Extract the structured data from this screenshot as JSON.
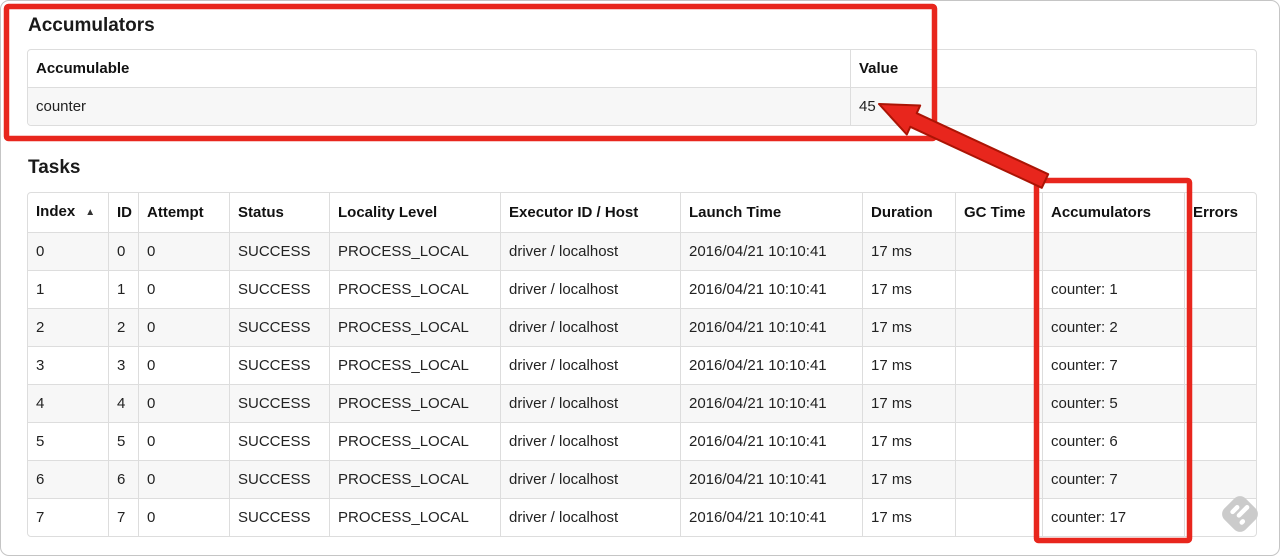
{
  "accumulators_section": {
    "heading": "Accumulators",
    "table": {
      "headers": [
        "Accumulable",
        "Value"
      ],
      "rows": [
        {
          "accumulable": "counter",
          "value": "45"
        }
      ]
    }
  },
  "tasks_section": {
    "heading": "Tasks",
    "table": {
      "headers": [
        "Index",
        "ID",
        "Attempt",
        "Status",
        "Locality Level",
        "Executor ID / Host",
        "Launch Time",
        "Duration",
        "GC Time",
        "Accumulators",
        "Errors"
      ],
      "sort_icon": "▲",
      "sorted_column": "Index",
      "rows": [
        {
          "index": "0",
          "id": "0",
          "attempt": "0",
          "status": "SUCCESS",
          "locality": "PROCESS_LOCAL",
          "executor": "driver / localhost",
          "launch_time": "2016/04/21 10:10:41",
          "duration": "17 ms",
          "gc_time": "",
          "accumulators": "",
          "errors": ""
        },
        {
          "index": "1",
          "id": "1",
          "attempt": "0",
          "status": "SUCCESS",
          "locality": "PROCESS_LOCAL",
          "executor": "driver / localhost",
          "launch_time": "2016/04/21 10:10:41",
          "duration": "17 ms",
          "gc_time": "",
          "accumulators": "counter: 1",
          "errors": ""
        },
        {
          "index": "2",
          "id": "2",
          "attempt": "0",
          "status": "SUCCESS",
          "locality": "PROCESS_LOCAL",
          "executor": "driver / localhost",
          "launch_time": "2016/04/21 10:10:41",
          "duration": "17 ms",
          "gc_time": "",
          "accumulators": "counter: 2",
          "errors": ""
        },
        {
          "index": "3",
          "id": "3",
          "attempt": "0",
          "status": "SUCCESS",
          "locality": "PROCESS_LOCAL",
          "executor": "driver / localhost",
          "launch_time": "2016/04/21 10:10:41",
          "duration": "17 ms",
          "gc_time": "",
          "accumulators": "counter: 7",
          "errors": ""
        },
        {
          "index": "4",
          "id": "4",
          "attempt": "0",
          "status": "SUCCESS",
          "locality": "PROCESS_LOCAL",
          "executor": "driver / localhost",
          "launch_time": "2016/04/21 10:10:41",
          "duration": "17 ms",
          "gc_time": "",
          "accumulators": "counter: 5",
          "errors": ""
        },
        {
          "index": "5",
          "id": "5",
          "attempt": "0",
          "status": "SUCCESS",
          "locality": "PROCESS_LOCAL",
          "executor": "driver / localhost",
          "launch_time": "2016/04/21 10:10:41",
          "duration": "17 ms",
          "gc_time": "",
          "accumulators": "counter: 6",
          "errors": ""
        },
        {
          "index": "6",
          "id": "6",
          "attempt": "0",
          "status": "SUCCESS",
          "locality": "PROCESS_LOCAL",
          "executor": "driver / localhost",
          "launch_time": "2016/04/21 10:10:41",
          "duration": "17 ms",
          "gc_time": "",
          "accumulators": "counter: 7",
          "errors": ""
        },
        {
          "index": "7",
          "id": "7",
          "attempt": "0",
          "status": "SUCCESS",
          "locality": "PROCESS_LOCAL",
          "executor": "driver / localhost",
          "launch_time": "2016/04/21 10:10:41",
          "duration": "17 ms",
          "gc_time": "",
          "accumulators": "counter: 17",
          "errors": ""
        }
      ]
    }
  },
  "annotations": {
    "color": "#e8261d",
    "outline_color": "#ab1405",
    "boxes": [
      "accumulators-section",
      "accumulators-column"
    ],
    "arrow_target": "45"
  },
  "watermark": {
    "icon": "feedly-logo-icon",
    "color": "#cbcbcb"
  }
}
